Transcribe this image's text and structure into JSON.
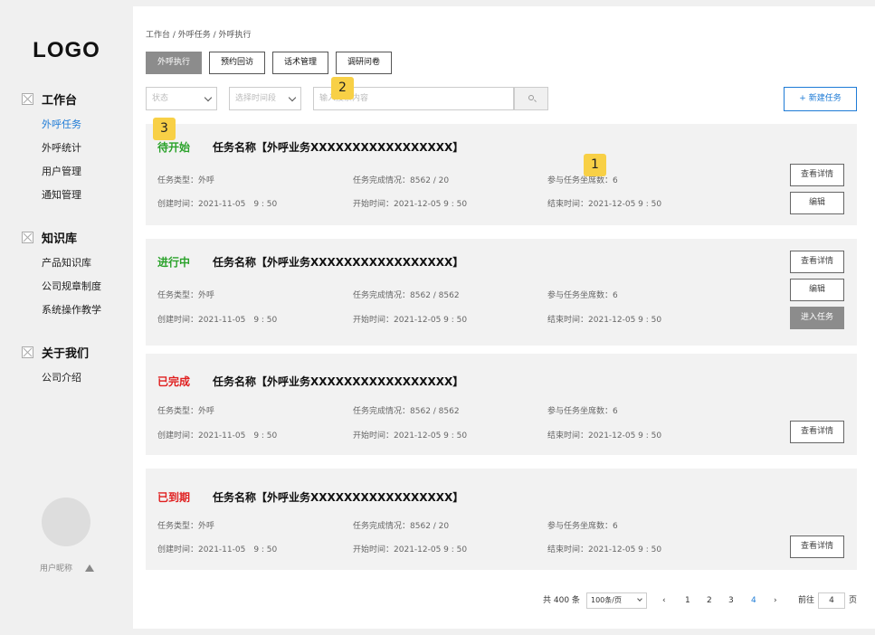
{
  "sidebar": {
    "logo": "LOGO",
    "groups": [
      {
        "title": "工作台",
        "items": [
          "外呼任务",
          "外呼统计",
          "用户管理",
          "通知管理"
        ]
      },
      {
        "title": "知识库",
        "items": [
          "产品知识库",
          "公司规章制度",
          "系统操作教学"
        ]
      },
      {
        "title": "关于我们",
        "items": [
          "公司介绍"
        ]
      }
    ],
    "username": "用户昵称"
  },
  "breadcrumb": "工作台 / 外呼任务 / 外呼执行",
  "tabs": [
    "外呼执行",
    "预约回访",
    "话术管理",
    "调研问卷"
  ],
  "filters": {
    "status_placeholder": "状态",
    "time_placeholder": "选择时间段",
    "search_placeholder": "输入搜索内容"
  },
  "new_task_label": "+ 新建任务",
  "badges": [
    "1",
    "2",
    "3"
  ],
  "labels": {
    "type": "任务类型：",
    "progress": "任务完成情况：",
    "seats": "参与任务坐席数：",
    "created": "创建时间：",
    "start": "开始时间：",
    "end": "结束时间："
  },
  "cards": [
    {
      "status": "待开始",
      "status_color": "#2aa22a",
      "name": "任务名称【外呼业务XXXXXXXXXXXXXXXXX】",
      "type": "外呼",
      "progress": "8562 / 20",
      "seats": "6",
      "created": "2021-11-05　9 : 50",
      "start": "2021-12-05  9 : 50",
      "end": "2021-12-05  9 : 50",
      "buttons": [
        "查看详情",
        "编辑"
      ]
    },
    {
      "status": "进行中",
      "status_color": "#2aa22a",
      "name": "任务名称【外呼业务XXXXXXXXXXXXXXXXX】",
      "type": "外呼",
      "progress": "8562 / 8562",
      "seats": "6",
      "created": "2021-11-05　9 : 50",
      "start": "2021-12-05  9 : 50",
      "end": "2021-12-05  9 : 50",
      "buttons": [
        "查看详情",
        "编辑",
        "进入任务"
      ]
    },
    {
      "status": "已完成",
      "status_color": "#e02020",
      "name": "任务名称【外呼业务XXXXXXXXXXXXXXXXX】",
      "type": "外呼",
      "progress": "8562 / 8562",
      "seats": "6",
      "created": "2021-11-05　9 : 50",
      "start": "2021-12-05  9 : 50",
      "end": "2021-12-05  9 : 50",
      "buttons": [
        "查看详情"
      ]
    },
    {
      "status": "已到期",
      "status_color": "#e02020",
      "name": "任务名称【外呼业务XXXXXXXXXXXXXXXXX】",
      "type": "外呼",
      "progress": "8562 / 20",
      "seats": "6",
      "created": "2021-11-05　9 : 50",
      "start": "2021-12-05  9 : 50",
      "end": "2021-12-05  9 : 50",
      "buttons": [
        "查看详情"
      ]
    }
  ],
  "pagination": {
    "total": "共 400 条",
    "page_size": "100条/页",
    "prev": "‹",
    "pages": [
      "1",
      "2",
      "3",
      "4"
    ],
    "current": "4",
    "next": "›",
    "goto_label": "前往",
    "goto_value": "4",
    "goto_suffix": "页"
  }
}
